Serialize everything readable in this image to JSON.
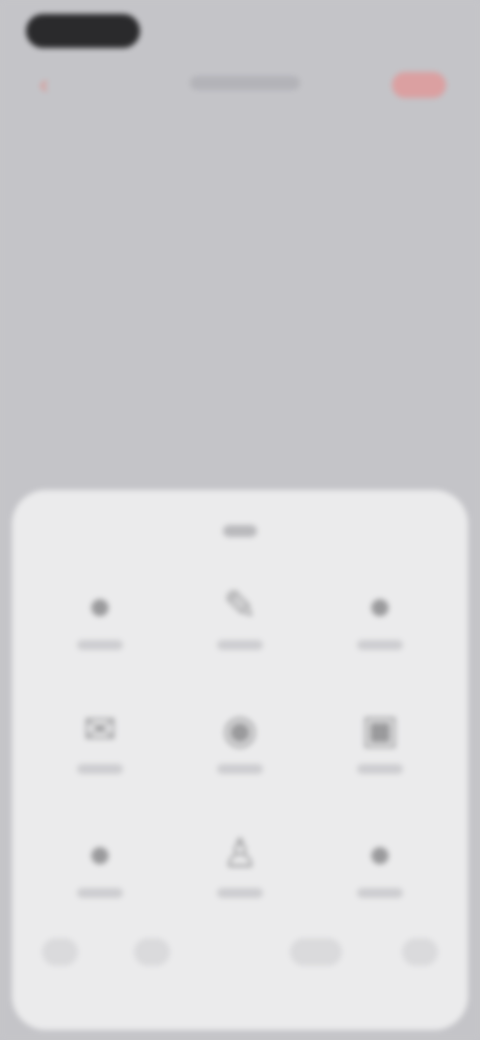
{
  "status_bar": {},
  "nav_bar": {
    "back_icon": "chevron-left-icon",
    "title": "",
    "action_label": ""
  },
  "sheet": {
    "title": "",
    "items": [
      {
        "icon": "circle-icon",
        "label": ""
      },
      {
        "icon": "pencil-icon",
        "label": ""
      },
      {
        "icon": "circle-icon",
        "label": ""
      },
      {
        "icon": "mail-icon",
        "label": ""
      },
      {
        "icon": "message-icon",
        "label": ""
      },
      {
        "icon": "note-icon",
        "label": ""
      },
      {
        "icon": "circle-icon",
        "label": ""
      },
      {
        "icon": "person-icon",
        "label": ""
      },
      {
        "icon": "circle-icon",
        "label": ""
      }
    ]
  },
  "colors": {
    "background": "#c4c4c8",
    "sheet": "#ebebec",
    "accent": "#e2867f",
    "status_pill": "#2a2a2c"
  }
}
